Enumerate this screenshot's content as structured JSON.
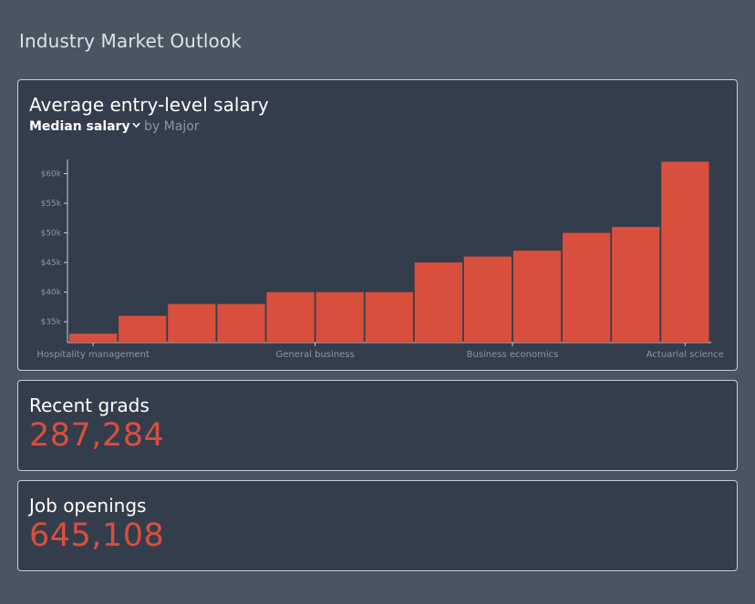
{
  "page": {
    "title": "Industry Market Outlook"
  },
  "salary_card": {
    "title": "Average entry-level salary",
    "metric_label": "Median salary",
    "by_text": "by",
    "group_label": "Major"
  },
  "grads_card": {
    "title": "Recent grads",
    "value": "287,284"
  },
  "jobs_card": {
    "title": "Job openings",
    "value": "645,108"
  },
  "colors": {
    "bar": "#d94f3d",
    "accent_value": "#d94f3d",
    "card_bg": "#343d4c",
    "page_bg": "#4a5561"
  },
  "chart_data": {
    "type": "bar",
    "values": [
      33000,
      36000,
      38000,
      38000,
      40000,
      40000,
      40000,
      45000,
      46000,
      47000,
      50000,
      51000,
      62000
    ],
    "x_tick_labels": [
      {
        "index": 0,
        "label": "Hospitality management"
      },
      {
        "index": 4.5,
        "label": "General business"
      },
      {
        "index": 8.5,
        "label": "Business economics"
      },
      {
        "index": 12,
        "label": "Actuarial science"
      }
    ],
    "y_ticks": [
      35000,
      40000,
      45000,
      50000,
      55000,
      60000
    ],
    "y_tick_labels": [
      "$35k",
      "$40k",
      "$45k",
      "$50k",
      "$55k",
      "$60k"
    ],
    "ylim": [
      31500,
      63000
    ],
    "grid": false,
    "xlabel": "",
    "ylabel": ""
  }
}
